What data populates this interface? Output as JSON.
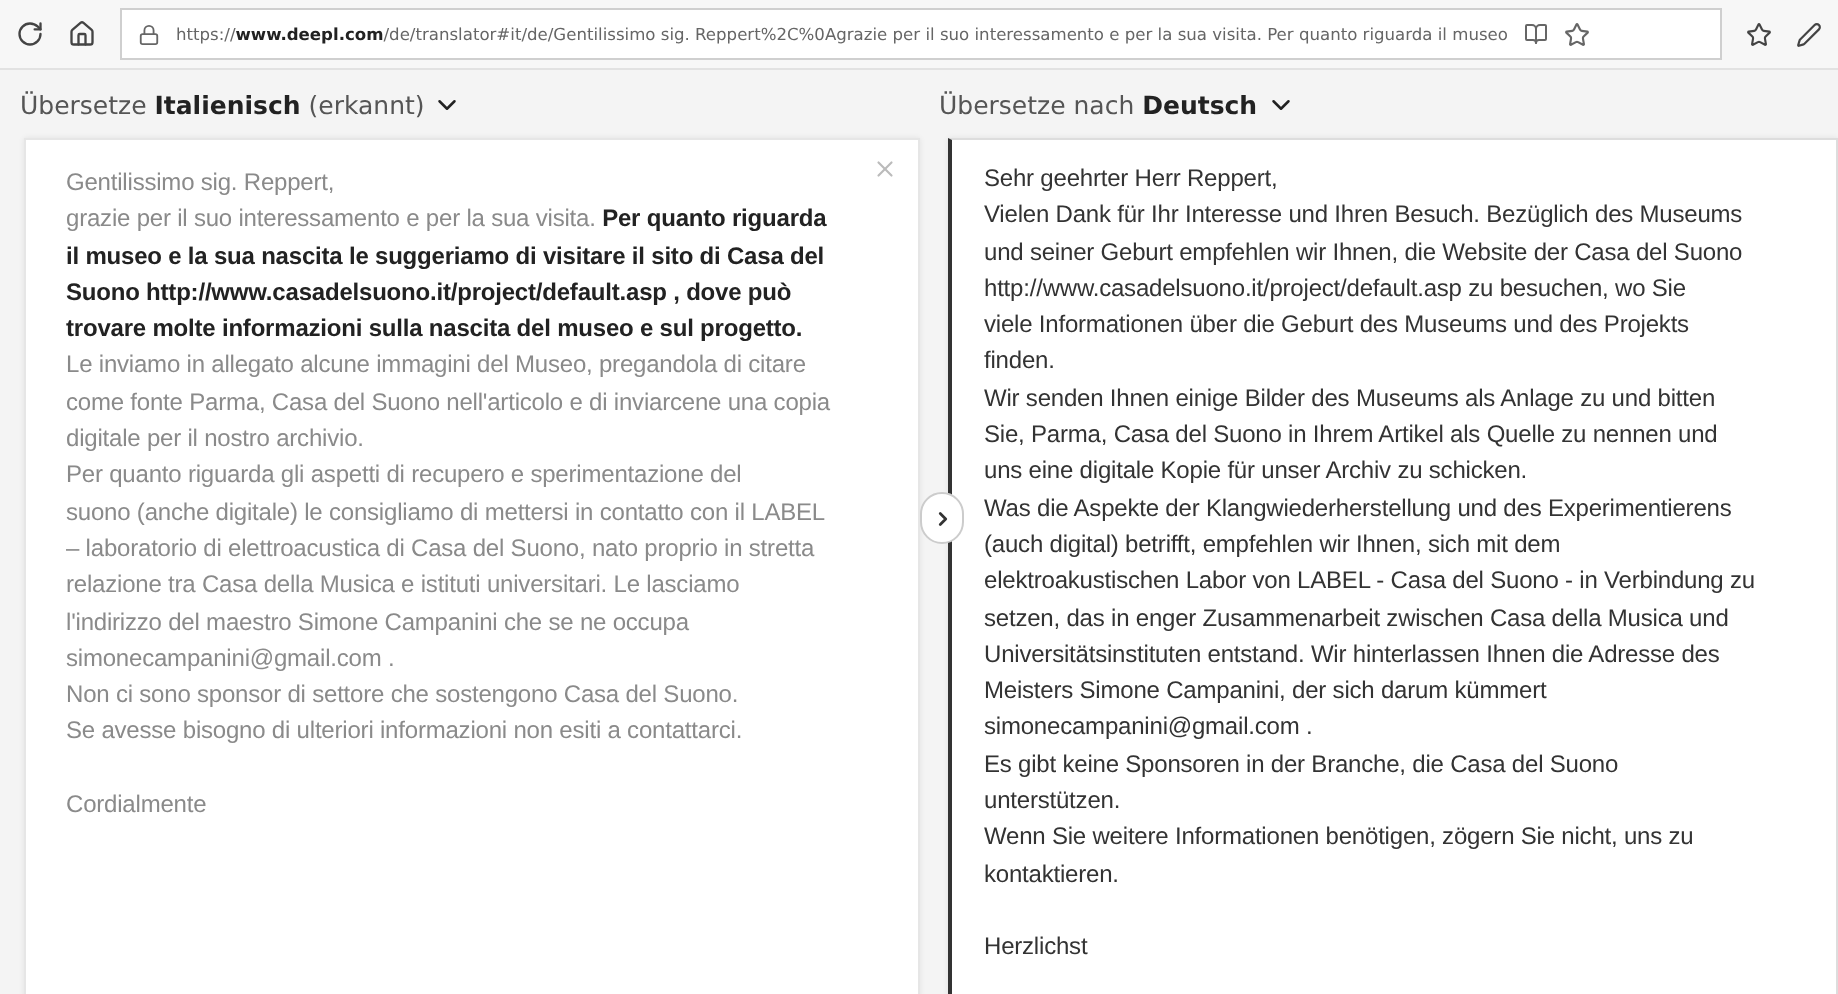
{
  "browser": {
    "url_prefix": "https://",
    "url_domain": "www.deepl.com",
    "url_rest": "/de/translator#it/de/Gentilissimo sig. Reppert%2C%0Agrazie per il suo interessamento e per la sua visita. Per quanto riguarda il museo"
  },
  "source_header": {
    "prefix": "Übersetze ",
    "language": "Italienisch",
    "suffix": " (erkannt)"
  },
  "target_header": {
    "prefix": "Übersetze nach ",
    "language": "Deutsch"
  },
  "source_lines": [
    "Gentilissimo sig. Reppert,",
    "grazie per il suo interessamento e per la sua visita. **Per quanto riguarda**",
    "**il museo e la sua nascita le suggeriamo di visitare il sito di Casa del**",
    "**Suono http://www.casadelsuono.it/project/default.asp , dove può**",
    "**trovare molte informazioni sulla nascita del museo e sul progetto.**",
    "Le inviamo in allegato alcune immagini del Museo, pregandola di citare",
    "come fonte Parma, Casa del Suono nell'articolo e di inviarcene una copia",
    "digitale per il nostro archivio.",
    "Per quanto riguarda gli aspetti  di  recupero e sperimentazione del",
    "suono (anche digitale) le consigliamo di mettersi in contatto con il LABEL",
    "– laboratorio di elettroacustica di Casa del Suono, nato proprio in stretta",
    "relazione tra Casa della Musica e istituti universitari. Le lasciamo",
    "l'indirizzo del maestro Simone Campanini che se ne occupa",
    "simonecampanini@gmail.com .",
    "Non ci sono sponsor di settore  che sostengono Casa del Suono.",
    "Se avesse bisogno di ulteriori informazioni non esiti a contattarci.",
    {
      "text": "Cordialmente",
      "space_before": true
    }
  ],
  "target_lines": [
    "Sehr geehrter Herr Reppert,",
    "Vielen Dank für Ihr Interesse und Ihren Besuch. Bezüglich des Museums",
    "und seiner Geburt empfehlen wir Ihnen, die Website der Casa del Suono",
    "http://www.casadelsuono.it/project/default.asp zu besuchen, wo Sie",
    "viele Informationen über die Geburt des Museums und des Projekts",
    "finden.",
    "Wir senden Ihnen einige Bilder des Museums als Anlage zu und bitten",
    "Sie, Parma, Casa del Suono in Ihrem Artikel als Quelle zu nennen und",
    "uns eine digitale Kopie für unser Archiv zu schicken.",
    "Was die Aspekte der Klangwiederherstellung und des Experimentierens",
    "(auch digital) betrifft, empfehlen wir Ihnen, sich mit dem",
    "elektroakustischen Labor von LABEL - Casa del Suono - in Verbindung zu",
    "setzen, das in enger Zusammenarbeit zwischen Casa della Musica und",
    "Universitätsinstituten entstand. Wir hinterlassen Ihnen die Adresse des",
    "Meisters Simone Campanini, der sich darum kümmert",
    "simonecampanini@gmail.com .",
    "Es gibt keine Sponsoren in der Branche, die Casa del Suono",
    "unterstützen.",
    "Wenn Sie weitere Informationen benötigen, zögern Sie nicht, uns zu",
    "kontaktieren.",
    {
      "text": "Herzlichst",
      "space_before": true
    }
  ]
}
